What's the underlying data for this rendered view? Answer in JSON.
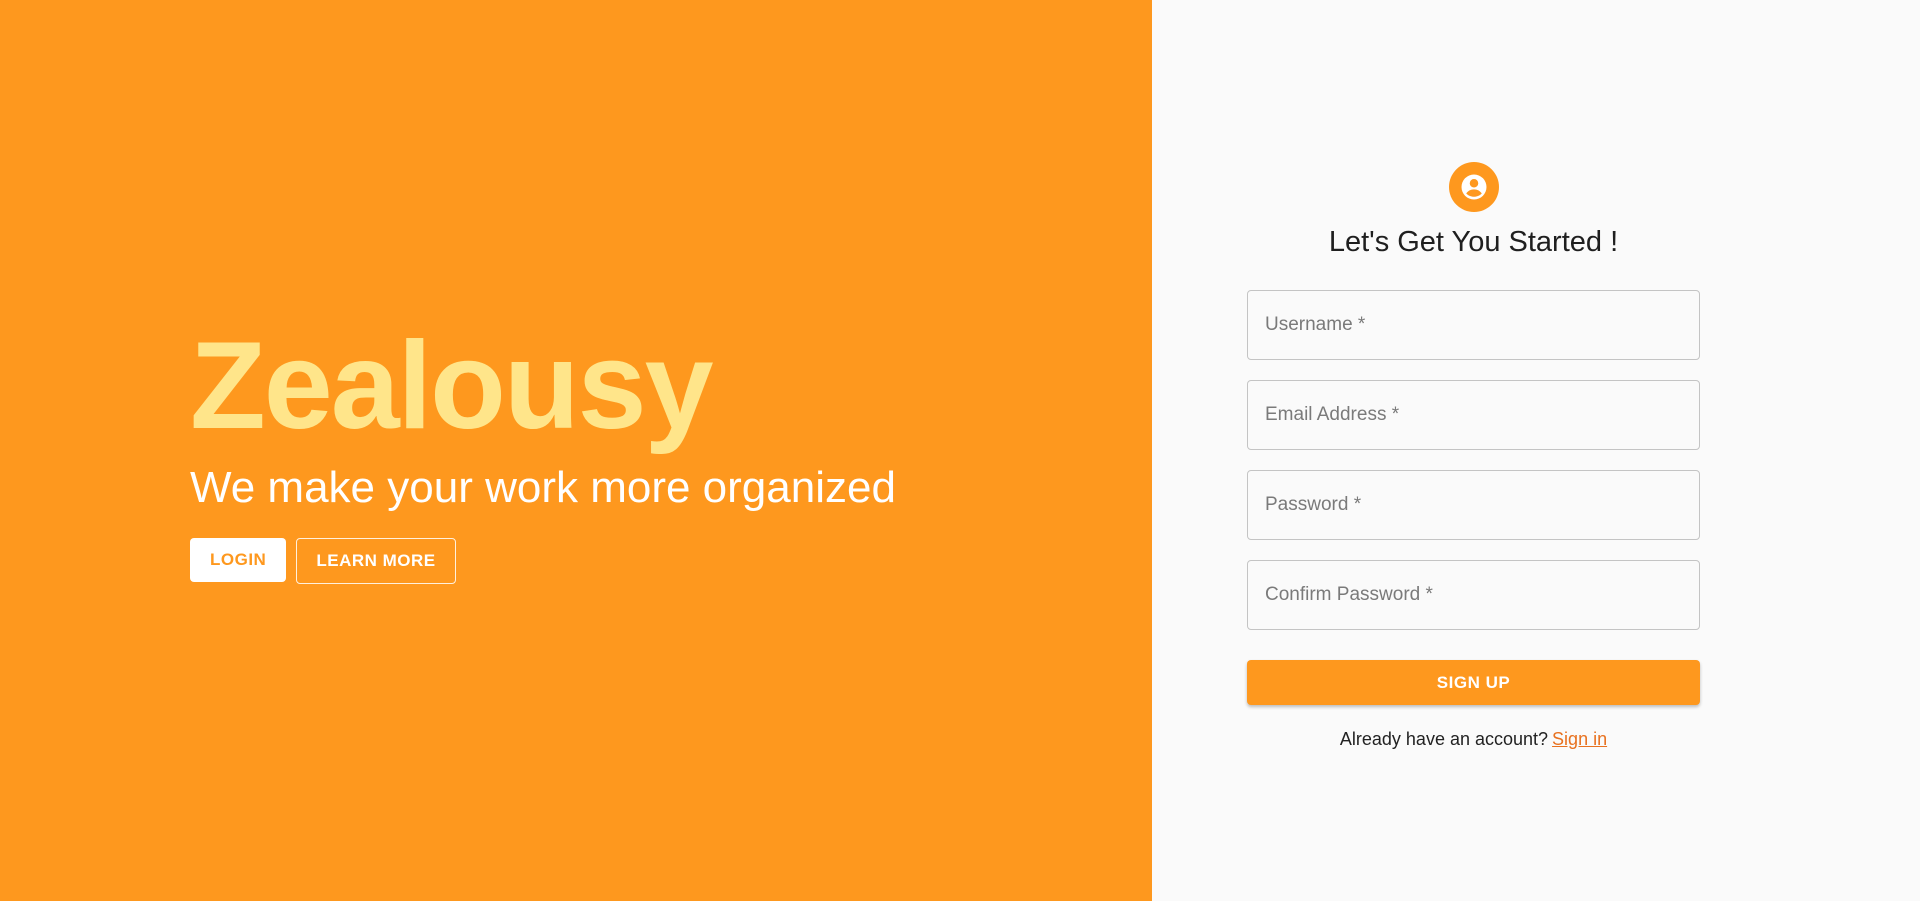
{
  "hero": {
    "brand": "Zealousy",
    "tagline": "We make your work more organized",
    "login_label": "LOGIN",
    "learn_more_label": "LEARN MORE"
  },
  "signup": {
    "icon": "account-circle-icon",
    "title": "Let's Get You Started !",
    "fields": [
      {
        "placeholder": "Username *",
        "value": ""
      },
      {
        "placeholder": "Email Address *",
        "value": ""
      },
      {
        "placeholder": "Password *",
        "value": ""
      },
      {
        "placeholder": "Confirm Password *",
        "value": ""
      }
    ],
    "submit_label": "SIGN UP",
    "account_prompt": "Already have an account?",
    "signin_label": "Sign in"
  },
  "colors": {
    "accent": "#fe981e",
    "brand_text": "#ffe58a",
    "panel_bg": "#fafafa",
    "link": "#e8711f"
  }
}
